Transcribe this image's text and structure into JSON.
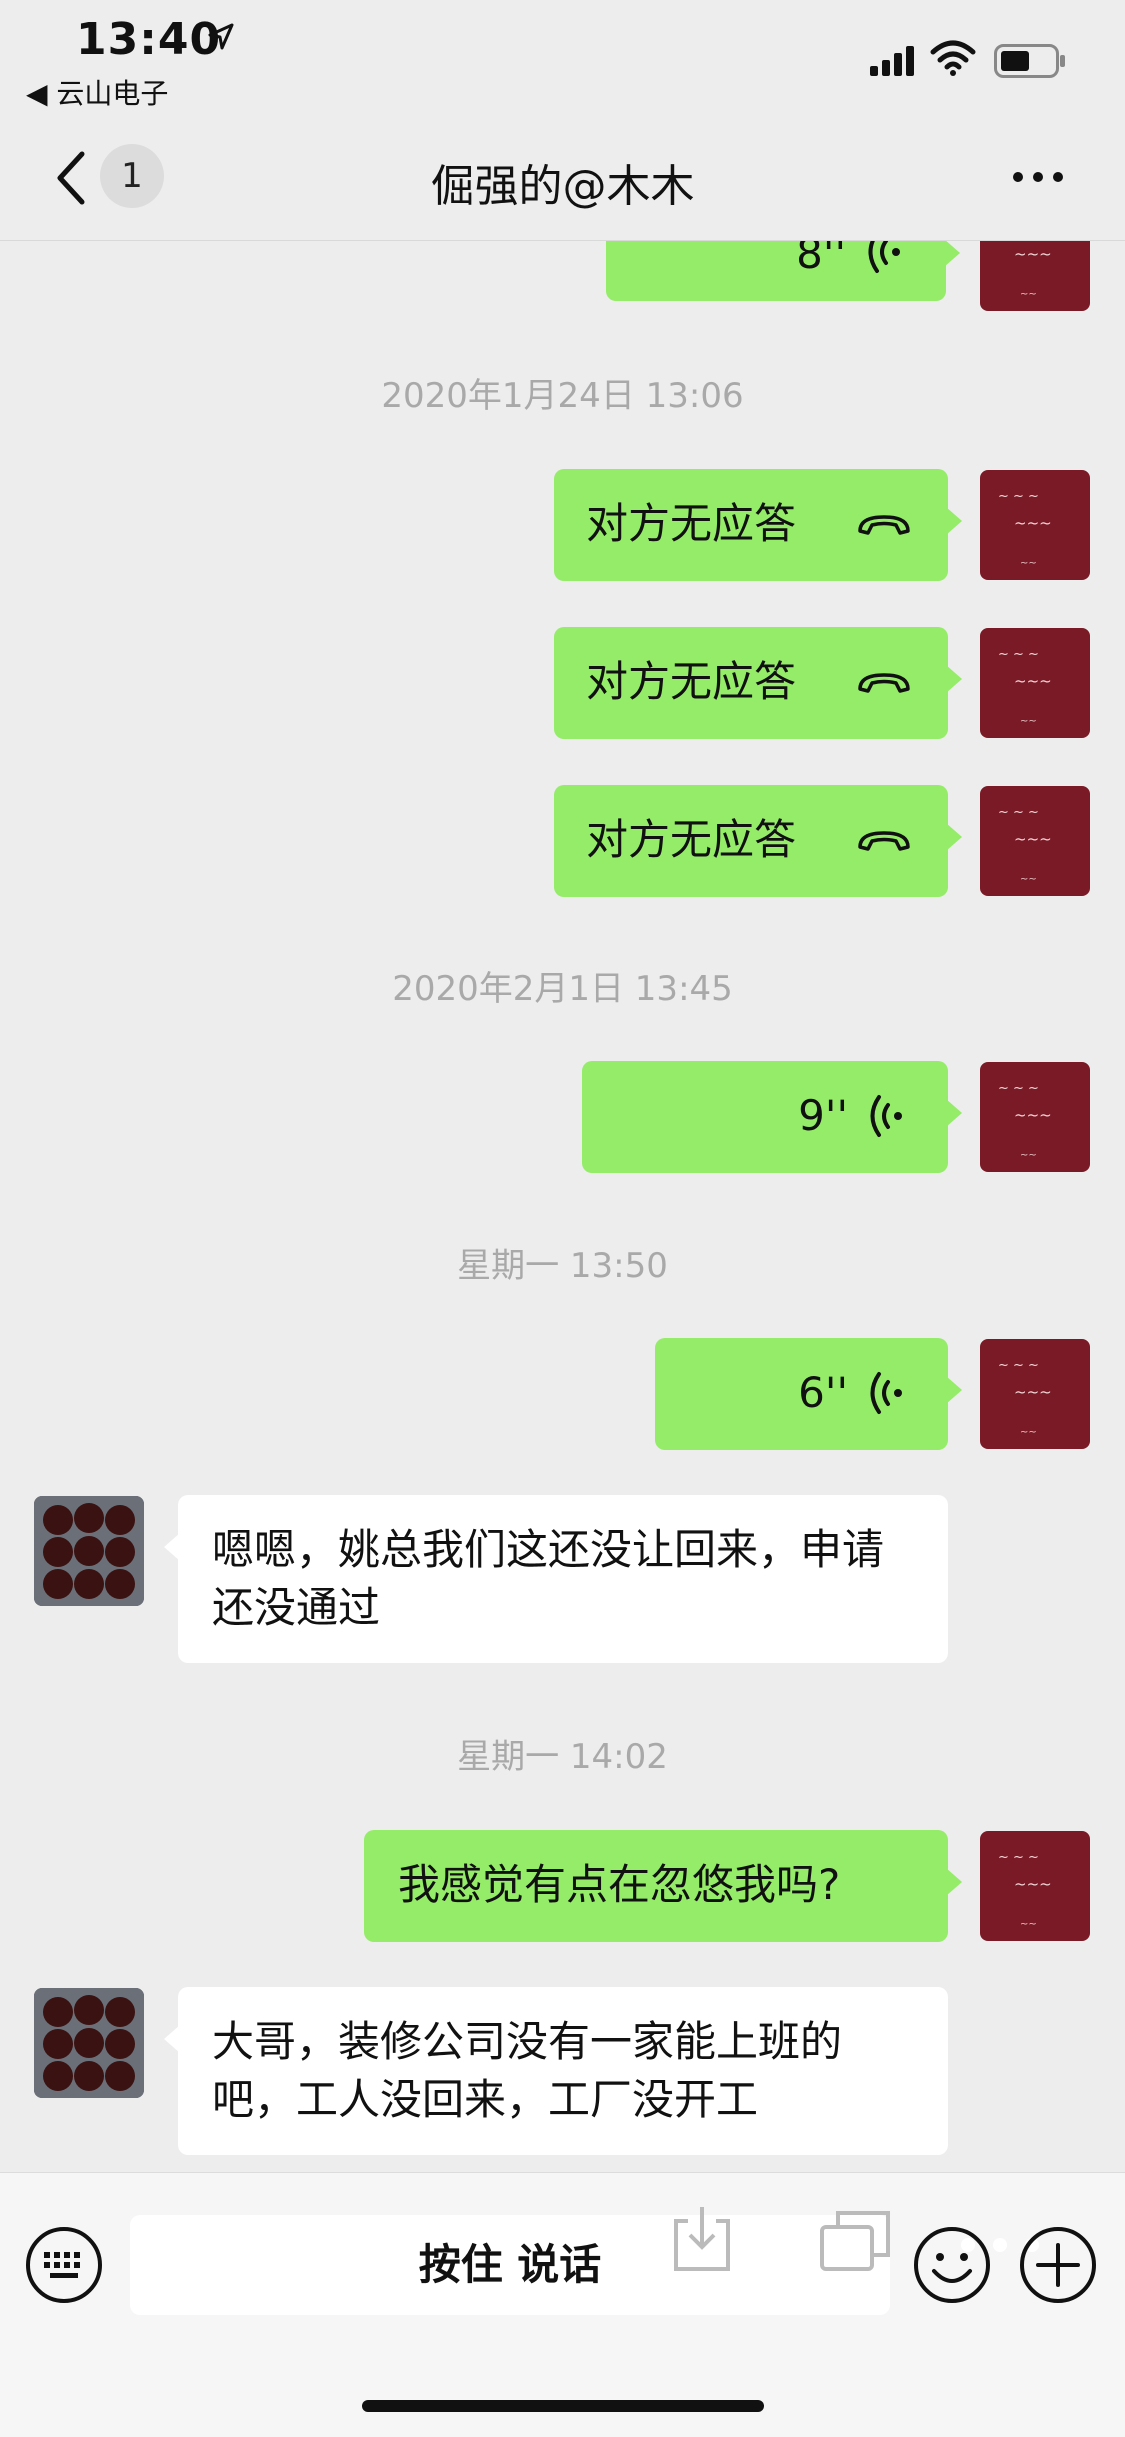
{
  "status_bar": {
    "time": "13:40",
    "back_app": "◀ 云山电子"
  },
  "nav": {
    "badge": "1",
    "title": "倔强的@木木"
  },
  "messages": {
    "top_voice_duration": "8''",
    "ts1": "2020年1月24日 13:06",
    "call1": "对方无应答",
    "call2": "对方无应答",
    "call3": "对方无应答",
    "ts2": "2020年2月1日 13:45",
    "voice2_duration": "9''",
    "ts3": "星期一 13:50",
    "voice3_duration": "6''",
    "recv1": "嗯嗯，姚总我们这还没让回来，申请还没通过",
    "ts4": "星期一 14:02",
    "sent1": "我感觉有点在忽悠我吗?",
    "recv2": "大哥，装修公司没有一家能上班的吧，工人没回来，工厂没开工"
  },
  "input_bar": {
    "hold_to_talk": "按住 说话"
  },
  "colors": {
    "sent_bubble": "#95ec69",
    "recv_bubble": "#ffffff",
    "background": "#ededed",
    "self_avatar": "#7a1a26"
  }
}
